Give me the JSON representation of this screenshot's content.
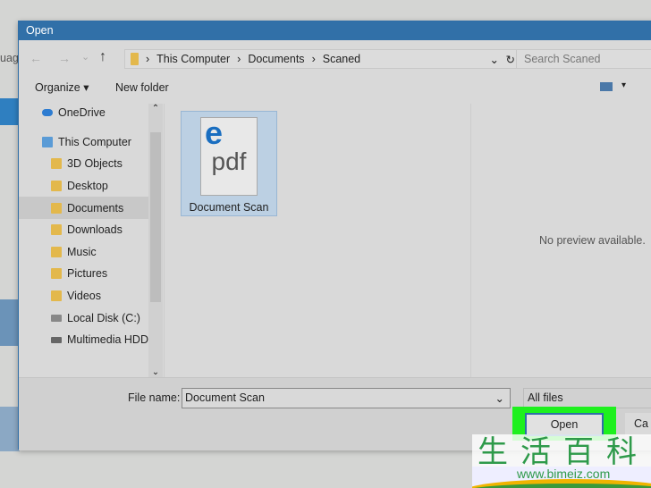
{
  "background": {
    "partial_text": "uag"
  },
  "dialog": {
    "title": "Open",
    "nav": {
      "back": "←",
      "forward": "→",
      "recent": "⌄",
      "up": "↑"
    },
    "breadcrumb": [
      "This Computer",
      "Documents",
      "Scaned"
    ],
    "search_placeholder": "Search Scaned",
    "toolbar": {
      "organize": "Organize ▾",
      "new_folder": "New folder",
      "view": "▾"
    },
    "sidebar": [
      {
        "label": "OneDrive",
        "icon": "cloud-icon"
      },
      {
        "label": "This Computer",
        "icon": "computer-icon"
      },
      {
        "label": "3D Objects",
        "icon": "folder-icon"
      },
      {
        "label": "Desktop",
        "icon": "folder-icon"
      },
      {
        "label": "Documents",
        "icon": "folder-icon",
        "selected": true
      },
      {
        "label": "Downloads",
        "icon": "folder-icon"
      },
      {
        "label": "Music",
        "icon": "folder-icon"
      },
      {
        "label": "Pictures",
        "icon": "folder-icon"
      },
      {
        "label": "Videos",
        "icon": "folder-icon"
      },
      {
        "label": "Local Disk (C:)",
        "icon": "drive-icon"
      },
      {
        "label": "Multimedia HDD",
        "icon": "drive-icon"
      }
    ],
    "files": [
      {
        "name": "Document Scan",
        "icon_text": "pdf",
        "icon_letter": "e"
      }
    ],
    "preview_text": "No preview available.",
    "file_name_label": "File name:",
    "file_name_value": "Document Scan",
    "file_type": "All files",
    "open_label": "Open",
    "cancel_label": "Ca",
    "highlight_color": "#1ef01e"
  },
  "watermark": {
    "logo_text": "生活百科",
    "url": "www.bimeiz.com"
  }
}
